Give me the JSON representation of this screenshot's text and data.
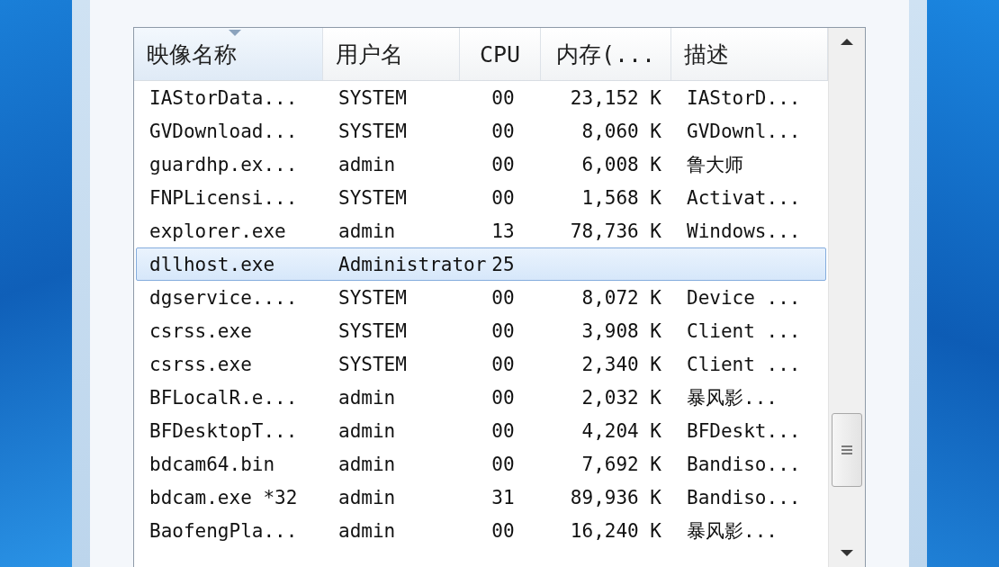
{
  "process_table": {
    "columns": [
      {
        "label": "映像名称",
        "sorted": true
      },
      {
        "label": "用户名",
        "sorted": false
      },
      {
        "label": "CPU",
        "sorted": false
      },
      {
        "label": "内存(...",
        "sorted": false
      },
      {
        "label": "描述",
        "sorted": false
      }
    ],
    "rows": [
      {
        "name": "IAStorData...",
        "user": "SYSTEM",
        "cpu": "00",
        "memory": "23,152 K",
        "description": "IAStorD...",
        "selected": false
      },
      {
        "name": "GVDownload...",
        "user": "SYSTEM",
        "cpu": "00",
        "memory": "8,060 K",
        "description": "GVDownl...",
        "selected": false
      },
      {
        "name": "guardhp.ex...",
        "user": "admin",
        "cpu": "00",
        "memory": "6,008 K",
        "description": "鲁大师",
        "selected": false
      },
      {
        "name": "FNPLicensi...",
        "user": "SYSTEM",
        "cpu": "00",
        "memory": "1,568 K",
        "description": "Activat...",
        "selected": false
      },
      {
        "name": "explorer.exe",
        "user": "admin",
        "cpu": "13",
        "memory": "78,736 K",
        "description": "Windows...",
        "selected": false
      },
      {
        "name": "dllhost.exe",
        "user": "Administrator",
        "cpu": "25",
        "selected": true
      },
      {
        "name": "dgservice....",
        "user": "SYSTEM",
        "cpu": "00",
        "memory": "8,072 K",
        "description": "Device ...",
        "selected": false
      },
      {
        "name": "csrss.exe",
        "user": "SYSTEM",
        "cpu": "00",
        "memory": "3,908 K",
        "description": "Client ...",
        "selected": false
      },
      {
        "name": "csrss.exe",
        "user": "SYSTEM",
        "cpu": "00",
        "memory": "2,340 K",
        "description": "Client ...",
        "selected": false
      },
      {
        "name": "BFLocalR.e...",
        "user": "admin",
        "cpu": "00",
        "memory": "2,032 K",
        "description": "暴风影...",
        "selected": false
      },
      {
        "name": "BFDesktopT...",
        "user": "admin",
        "cpu": "00",
        "memory": "4,204 K",
        "description": "BFDeskt...",
        "selected": false
      },
      {
        "name": "bdcam64.bin",
        "user": "admin",
        "cpu": "00",
        "memory": "7,692 K",
        "description": "Bandiso...",
        "selected": false
      },
      {
        "name": "bdcam.exe *32",
        "user": "admin",
        "cpu": "31",
        "memory": "89,936 K",
        "description": "Bandiso...",
        "selected": false
      },
      {
        "name": "BaofengPla...",
        "user": "admin",
        "cpu": "00",
        "memory": "16,240 K",
        "description": "暴风影...",
        "selected": false
      }
    ]
  }
}
